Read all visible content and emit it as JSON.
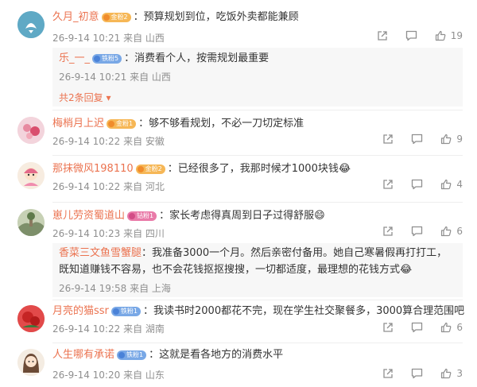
{
  "comments": [
    {
      "username": "久月_初意",
      "badge": "金粉2",
      "badge_color": "gold",
      "text": "预算规划到位，吃饭外卖都能兼顾",
      "timestamp": "26-9-14 10:21",
      "location": "来自 山西",
      "like_count": "19",
      "replies": [
        {
          "username": "乐_一_",
          "badge": "铁粉5",
          "badge_color": "blue",
          "text": "消费看个人，按需规划最重要",
          "timestamp": "26-9-14 10:21",
          "location": "来自 山西"
        }
      ],
      "more_replies": "共2条回复"
    },
    {
      "username": "梅梢月上迟",
      "badge": "金粉1",
      "badge_color": "gold",
      "text": "够不够看规划，不必一刀切定标准",
      "timestamp": "26-9-14 10:22",
      "location": "来自 安徽",
      "like_count": "9"
    },
    {
      "username": "那抹微风198110",
      "badge": "金粉2",
      "badge_color": "gold",
      "text": "已经很多了，我那时候才1000块钱",
      "emoji": "😂",
      "timestamp": "26-9-14 10:22",
      "location": "来自 河北",
      "like_count": "4"
    },
    {
      "username": "崽儿劳资蜀道山",
      "badge": "钻粉1",
      "badge_color": "pink",
      "text": "家长考虑得真周到日子过得舒服",
      "emoji": "😄",
      "timestamp": "26-9-14 10:23",
      "location": "来自 四川",
      "like_count": "6",
      "replies": [
        {
          "username": "香菜三文鱼雪蟹腿",
          "text": "我准备3000一个月。然后亲密付备用。她自己寒暑假再打打工，既知道赚钱不容易，也不会花钱抠抠搜搜，一切都适度，最理想的花钱方式",
          "emoji": "😂",
          "timestamp": "26-9-14 19:58",
          "location": "来自 上海"
        }
      ]
    },
    {
      "username": "月亮的猫ssr",
      "badge": "铁粉1",
      "badge_color": "blue",
      "text": "我读书时2000都花不完，现在学生社交聚餐多，3000算合理范围吧",
      "timestamp": "26-9-14 10:22",
      "location": "来自 湖南",
      "like_count": "6"
    },
    {
      "username": "人生哪有承诺",
      "badge": "铁粉1",
      "badge_color": "blue",
      "text": "这就是看各地方的消费水平",
      "timestamp": "26-9-14 10:20",
      "location": "来自 山东",
      "like_count": "3"
    }
  ],
  "icons": {
    "share": "share-icon",
    "comment": "comment-icon",
    "like": "like-icon"
  },
  "colors": {
    "username": "#eb7350",
    "meta": "#8f8f8f",
    "reply_bg": "#f7f7f7"
  }
}
